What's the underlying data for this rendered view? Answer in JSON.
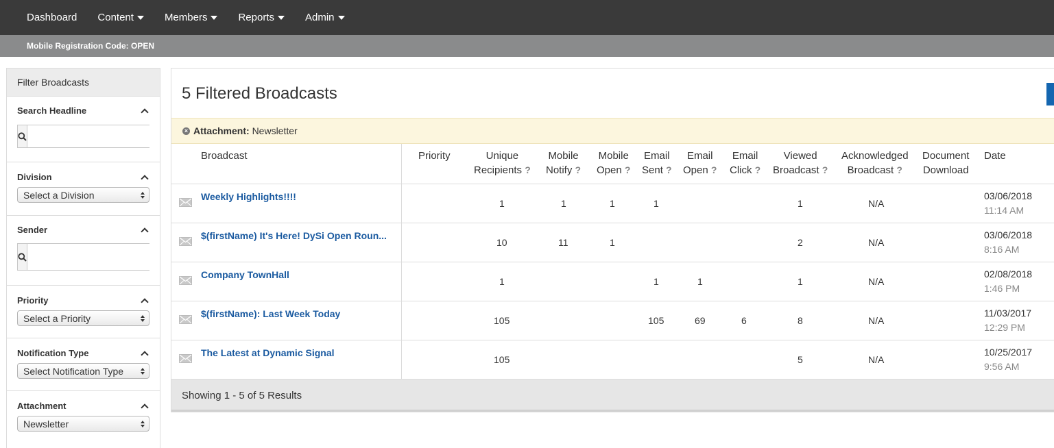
{
  "nav": {
    "items": [
      {
        "label": "Dashboard",
        "dropdown": false
      },
      {
        "label": "Content",
        "dropdown": true
      },
      {
        "label": "Members",
        "dropdown": true
      },
      {
        "label": "Reports",
        "dropdown": true
      },
      {
        "label": "Admin",
        "dropdown": true
      }
    ]
  },
  "subbar": {
    "text": "Mobile Registration Code: OPEN"
  },
  "sidebar": {
    "title": "Filter Broadcasts",
    "search_headline": {
      "label": "Search Headline",
      "value": "",
      "placeholder": ""
    },
    "division": {
      "label": "Division",
      "selected": "Select a Division"
    },
    "sender": {
      "label": "Sender",
      "value": "",
      "placeholder": ""
    },
    "priority": {
      "label": "Priority",
      "selected": "Select a Priority"
    },
    "notification_type": {
      "label": "Notification Type",
      "selected": "Select Notification Type"
    },
    "attachment": {
      "label": "Attachment",
      "selected": "Newsletter"
    }
  },
  "main": {
    "title": "5 Filtered Broadcasts",
    "active_filter": {
      "label": "Attachment:",
      "value": "Newsletter"
    },
    "columns": {
      "broadcast": "Broadcast",
      "priority": "Priority",
      "unique": [
        "Unique",
        "Recipients"
      ],
      "mobile_notify": [
        "Mobile",
        "Notify"
      ],
      "mobile_open": [
        "Mobile",
        "Open"
      ],
      "email_sent": [
        "Email",
        "Sent"
      ],
      "email_open": [
        "Email",
        "Open"
      ],
      "email_click": [
        "Email",
        "Click"
      ],
      "viewed": [
        "Viewed",
        "Broadcast"
      ],
      "acknowledged": [
        "Acknowledged",
        "Broadcast"
      ],
      "document": [
        "Document",
        "Download"
      ],
      "date": "Date",
      "help": "?"
    },
    "rows": [
      {
        "headline": "Weekly Highlights!!!!",
        "unique": "1",
        "mobile_notify": "1",
        "mobile_open": "1",
        "email_sent": "1",
        "email_open": "",
        "email_click": "",
        "viewed": "1",
        "acknowledged": "N/A",
        "date": "03/06/2018",
        "time": "11:14 AM"
      },
      {
        "headline": "$(firstName) It's Here! DySi Open Roun...",
        "unique": "10",
        "mobile_notify": "11",
        "mobile_open": "1",
        "email_sent": "",
        "email_open": "",
        "email_click": "",
        "viewed": "2",
        "acknowledged": "N/A",
        "date": "03/06/2018",
        "time": "8:16 AM"
      },
      {
        "headline": "Company TownHall",
        "unique": "1",
        "mobile_notify": "",
        "mobile_open": "",
        "email_sent": "1",
        "email_open": "1",
        "email_click": "",
        "viewed": "1",
        "acknowledged": "N/A",
        "date": "02/08/2018",
        "time": "1:46 PM"
      },
      {
        "headline": "$(firstName): Last Week Today",
        "unique": "105",
        "mobile_notify": "",
        "mobile_open": "",
        "email_sent": "105",
        "email_open": "69",
        "email_click": "6",
        "viewed": "8",
        "acknowledged": "N/A",
        "date": "11/03/2017",
        "time": "12:29 PM"
      },
      {
        "headline": "The Latest at Dynamic Signal",
        "unique": "105",
        "mobile_notify": "",
        "mobile_open": "",
        "email_sent": "",
        "email_open": "",
        "email_click": "",
        "viewed": "5",
        "acknowledged": "N/A",
        "date": "10/25/2017",
        "time": "9:56 AM"
      }
    ],
    "footer": "Showing 1 - 5 of 5 Results"
  },
  "icons": {
    "search": "search-icon",
    "envelope": "envelope-icon",
    "remove": "remove-filter-icon",
    "collapse": "chevron-up-icon"
  }
}
